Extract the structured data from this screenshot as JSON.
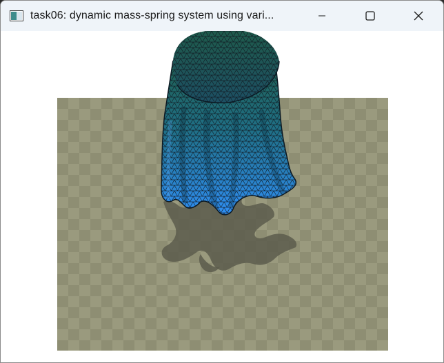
{
  "window": {
    "title": "task06: dynamic mass-spring system using vari...",
    "buttons": {
      "minimize": "minimize-icon",
      "maximize": "maximize-icon",
      "close": "close-icon"
    }
  },
  "viewport": {
    "background": "#ffffff",
    "floor_color_light": "#9a9a7e",
    "floor_color_dark": "#8e8e73",
    "shadow_color": "#5c5c4c",
    "cloth_color_top": "#1f5f50",
    "cloth_color_bottom": "#2f8ff5",
    "mesh_color": "#101820"
  }
}
